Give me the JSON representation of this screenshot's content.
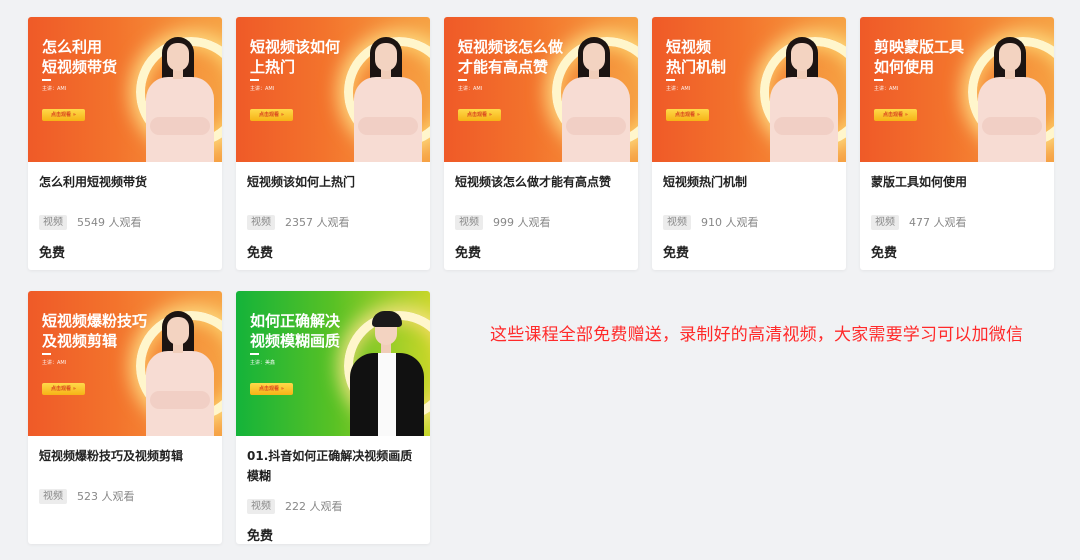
{
  "cards": [
    {
      "thumb_title": "怎么利用\n短视频带货",
      "lecturer": "主讲：AMI",
      "thumb_button": "点击观看 »",
      "title": "怎么利用短视频带货",
      "tag": "视频",
      "views": "5549 人观看",
      "price": "免费"
    },
    {
      "thumb_title": "短视频该如何\n上热门",
      "lecturer": "主讲：AMI",
      "thumb_button": "点击观看 »",
      "title": "短视频该如何上热门",
      "tag": "视频",
      "views": "2357 人观看",
      "price": "免费"
    },
    {
      "thumb_title": "短视频该怎么做\n才能有高点赞",
      "lecturer": "主讲：AMI",
      "thumb_button": "点击观看 »",
      "title": "短视频该怎么做才能有高点赞",
      "tag": "视频",
      "views": "999 人观看",
      "price": "免费"
    },
    {
      "thumb_title": "短视频\n热门机制",
      "lecturer": "主讲：AMI",
      "thumb_button": "点击观看 »",
      "title": "短视频热门机制",
      "tag": "视频",
      "views": "910 人观看",
      "price": "免费"
    },
    {
      "thumb_title": "剪映蒙版工具\n如何使用",
      "lecturer": "主讲：AMI",
      "thumb_button": "点击观看 »",
      "title": "蒙版工具如何使用",
      "tag": "视频",
      "views": "477 人观看",
      "price": "免费"
    },
    {
      "thumb_title": "短视频爆粉技巧\n及视频剪辑",
      "lecturer": "主讲：AMI",
      "thumb_button": "点击观看 »",
      "title": "短视频爆粉技巧及视频剪辑",
      "tag": "视频",
      "views": "523 人观看",
      "price": ""
    },
    {
      "thumb_title": "如何正确解决\n视频模糊画质",
      "lecturer": "主讲：美鑫",
      "thumb_button": "点击观看 »",
      "title": "01.抖音如何正确解决视频画质模糊",
      "tag": "视频",
      "views": "222 人观看",
      "price": "免费"
    }
  ],
  "notice": "这些课程全部免费赠送，录制好的高清视频，大家需要学习可以加微信",
  "colors": {
    "notice": "#ff2a2a",
    "orange_banner": "#f06a2b",
    "green_banner": "#2fb836"
  }
}
